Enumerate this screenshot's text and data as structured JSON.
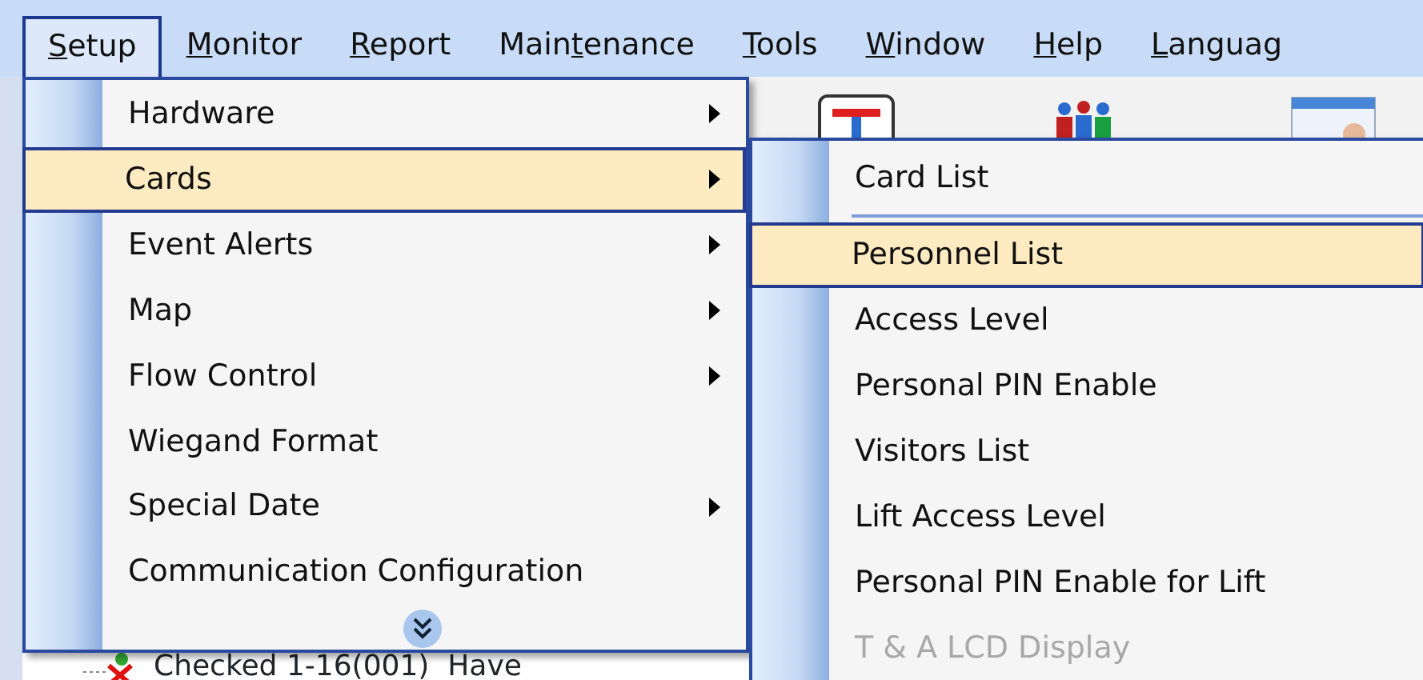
{
  "menu_bar": [
    {
      "key": "S",
      "after": "etup",
      "selected": true
    },
    {
      "key": "M",
      "after": "onitor",
      "selected": false
    },
    {
      "key": "R",
      "after": "eport",
      "selected": false
    },
    {
      "before": "Main",
      "key": "t",
      "after": "enance",
      "selected": false
    },
    {
      "key": "T",
      "after": "ools",
      "selected": false
    },
    {
      "key": "W",
      "after": "indow",
      "selected": false
    },
    {
      "key": "H",
      "after": "elp",
      "selected": false
    },
    {
      "key": "L",
      "after": "anguag",
      "selected": false
    }
  ],
  "tree": {
    "items": [
      {
        "label": "Checked 1-16(001)  Have"
      }
    ]
  },
  "setup_menu": {
    "items": [
      {
        "label": "Hardware",
        "submenu": true,
        "selected": false
      },
      {
        "label": "Cards",
        "submenu": true,
        "selected": true
      },
      {
        "label": "Event Alerts",
        "submenu": true,
        "selected": false
      },
      {
        "label": "Map",
        "submenu": true,
        "selected": false
      },
      {
        "label": "Flow Control",
        "submenu": true,
        "selected": false
      },
      {
        "label": "Wiegand Format",
        "submenu": false,
        "selected": false
      },
      {
        "label": "Special Date",
        "submenu": true,
        "selected": false
      },
      {
        "label": "Communication Configuration",
        "submenu": false,
        "selected": false
      }
    ]
  },
  "cards_submenu": {
    "items": [
      {
        "label": "Card List",
        "selected": false,
        "disabled": false,
        "separator_after": true
      },
      {
        "label": "Personnel List",
        "selected": true,
        "disabled": false,
        "separator_after": false
      },
      {
        "label": "Access Level",
        "selected": false,
        "disabled": false,
        "separator_after": false
      },
      {
        "label": "Personal PIN Enable",
        "selected": false,
        "disabled": false,
        "separator_after": false
      },
      {
        "label": "Visitors List",
        "selected": false,
        "disabled": false,
        "separator_after": false
      },
      {
        "label": "Lift Access Level",
        "selected": false,
        "disabled": false,
        "separator_after": false
      },
      {
        "label": "Personal PIN Enable for Lift",
        "selected": false,
        "disabled": false,
        "separator_after": false
      },
      {
        "label": "T & A LCD Display",
        "selected": false,
        "disabled": true,
        "separator_after": false
      }
    ]
  }
}
